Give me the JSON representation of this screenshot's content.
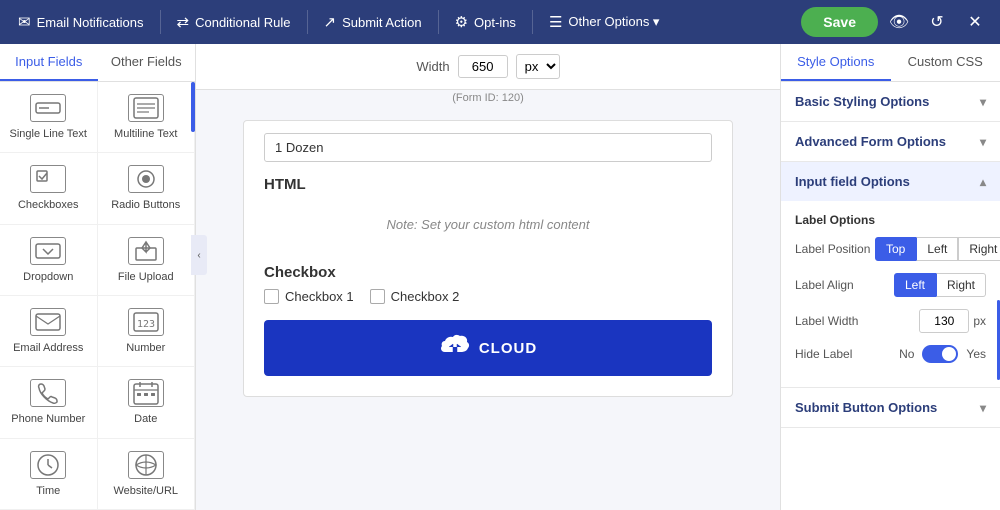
{
  "topnav": {
    "items": [
      {
        "id": "email-notifications",
        "icon": "✉",
        "label": "Email Notifications"
      },
      {
        "id": "conditional-rule",
        "icon": "⇄",
        "label": "Conditional Rule"
      },
      {
        "id": "submit-action",
        "icon": "↗",
        "label": "Submit Action"
      },
      {
        "id": "opt-ins",
        "icon": "⚙",
        "label": "Opt-ins"
      },
      {
        "id": "other-options",
        "icon": "☰",
        "label": "Other Options ▾"
      }
    ],
    "save_label": "Save"
  },
  "left_panel": {
    "tabs": [
      {
        "id": "input-fields",
        "label": "Input Fields"
      },
      {
        "id": "other-fields",
        "label": "Other Fields"
      }
    ],
    "active_tab": "input-fields",
    "fields": [
      {
        "id": "single-line-text",
        "label": "Single Line Text",
        "icon": "▬"
      },
      {
        "id": "multiline-text",
        "label": "Multiline Text",
        "icon": "≡"
      },
      {
        "id": "checkboxes",
        "label": "Checkboxes",
        "icon": "☑"
      },
      {
        "id": "radio-buttons",
        "label": "Radio Buttons",
        "icon": "◉"
      },
      {
        "id": "dropdown",
        "label": "Dropdown",
        "icon": "▼"
      },
      {
        "id": "file-upload",
        "label": "File Upload",
        "icon": "↑"
      },
      {
        "id": "email-address",
        "label": "Email Address",
        "icon": "✉"
      },
      {
        "id": "number",
        "label": "Number",
        "icon": "123"
      },
      {
        "id": "phone-number",
        "label": "Phone Number",
        "icon": "☎"
      },
      {
        "id": "date",
        "label": "Date",
        "icon": "📅"
      },
      {
        "id": "time",
        "label": "Time",
        "icon": "⏰"
      },
      {
        "id": "website-url",
        "label": "Website/URL",
        "icon": "🔗"
      }
    ]
  },
  "center": {
    "width_label": "Width",
    "width_value": "650",
    "width_unit": "px",
    "form_id": "(Form ID: 120)",
    "dropdown_value": "1 Dozen",
    "html_section_label": "HTML",
    "html_note": "Note: Set your custom html content",
    "checkbox_section_label": "Checkbox",
    "checkbox_items": [
      {
        "id": "cb1",
        "label": "Checkbox 1"
      },
      {
        "id": "cb2",
        "label": "Checkbox 2"
      }
    ],
    "submit_text": "CLOUD"
  },
  "right_panel": {
    "tabs": [
      {
        "id": "style-options",
        "label": "Style Options"
      },
      {
        "id": "custom-css",
        "label": "Custom CSS"
      }
    ],
    "active_tab": "style-options",
    "accordions": [
      {
        "id": "basic-styling",
        "label": "Basic Styling Options",
        "expanded": false
      },
      {
        "id": "advanced-form",
        "label": "Advanced Form Options",
        "expanded": false
      },
      {
        "id": "input-field",
        "label": "Input field Options",
        "expanded": true
      }
    ],
    "input_field_options": {
      "section_title": "Label Options",
      "label_position": {
        "label": "Label Position",
        "options": [
          "Top",
          "Left",
          "Right"
        ],
        "active": "Top"
      },
      "label_align": {
        "label": "Label Align",
        "options": [
          "Left",
          "Right"
        ],
        "active": "Left"
      },
      "label_width": {
        "label": "Label Width",
        "value": "130",
        "unit": "px"
      },
      "hide_label": {
        "label": "Hide Label",
        "no": "No",
        "yes": "Yes"
      }
    },
    "submit_button_options": {
      "label": "Submit Button Options"
    }
  }
}
